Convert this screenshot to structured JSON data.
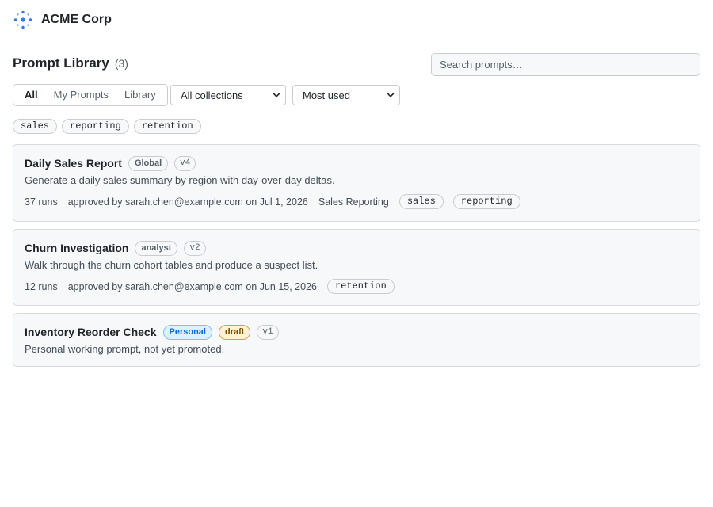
{
  "header": {
    "brand": "ACME Corp"
  },
  "library": {
    "title": "Prompt Library",
    "count": "(3)",
    "search_placeholder": "Search prompts…"
  },
  "filters": {
    "tabs": [
      {
        "label": "All",
        "active": true
      },
      {
        "label": "My Prompts",
        "active": false
      },
      {
        "label": "Library",
        "active": false
      }
    ],
    "collection": "All collections",
    "sort": "Most used"
  },
  "tags": [
    "sales",
    "reporting",
    "retention"
  ],
  "prompts": [
    {
      "title": "Daily Sales Report",
      "badges": [
        "Global"
      ],
      "version": "v4",
      "description": "Generate a daily sales summary by region with day-over-day deltas.",
      "runs": "37 runs",
      "approval": "approved by sarah.chen@example.com on Jul 1, 2026",
      "collection": "Sales Reporting",
      "tags": [
        "sales",
        "reporting"
      ]
    },
    {
      "title": "Churn Investigation",
      "badges": [
        "analyst"
      ],
      "version": "v2",
      "description": "Walk through the churn cohort tables and produce a suspect list.",
      "runs": "12 runs",
      "approval": "approved by sarah.chen@example.com on Jun 15, 2026",
      "tags": [
        "retention"
      ]
    },
    {
      "title": "Inventory Reorder Check",
      "badges": [
        "Personal",
        "draft"
      ],
      "version": "v1",
      "description": "Personal working prompt, not yet promoted."
    }
  ],
  "colors": {
    "accent_blue": "#0969da",
    "draft_amber": "#7d4e00",
    "card_bg": "#f6f8fa",
    "border": "#d8dadd"
  },
  "icons": {
    "logo": "dotted-ring-logo-icon",
    "dropdown": "chevron-down-icon"
  }
}
